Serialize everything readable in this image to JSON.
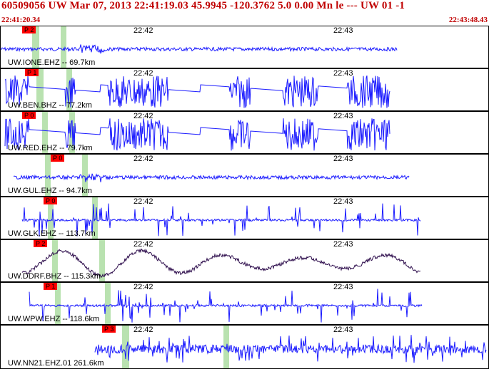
{
  "header": {
    "title": "60509056 UW Mar 07, 2013 22:41:19.03    45.9945 -120.3762  5.0 0.00 Mn le --- UW 01   -1",
    "start_time": "22:41:20.34",
    "end_time": "22:43:48.43"
  },
  "time_ticks": [
    "22:42",
    "22:43"
  ],
  "colors": {
    "trace": "#1a1aff",
    "trace_alt": "#2b0a4a",
    "pick": "#ff0000",
    "header_text": "#c00000",
    "green_band": "#b9e2b0"
  },
  "traces": [
    {
      "label": "UW.IONE.EHZ -- 69.7km",
      "pick": "P 2",
      "style": "quiet"
    },
    {
      "label": "UW.BEN.BHZ -- 77.2km",
      "pick": "P 1",
      "style": "bursts"
    },
    {
      "label": "UW.RED.EHZ -- 79.7km",
      "pick": "P 0",
      "style": "bursts"
    },
    {
      "label": "UW.GUL.EHZ -- 94.7km",
      "pick": "P 0",
      "style": "quiet"
    },
    {
      "label": "UW.GLK.EHZ -- 113.7km",
      "pick": "P 0",
      "style": "spikes"
    },
    {
      "label": "UW.DDRF.BHZ -- 115.3km",
      "pick": "P 2",
      "style": "wave"
    },
    {
      "label": "UW.WPW.EHZ -- 118.6km",
      "pick": "P 1",
      "style": "spikes"
    },
    {
      "label": "UW.NN21.EHZ.01 261.6km",
      "pick": "P 3",
      "style": "noise"
    }
  ]
}
